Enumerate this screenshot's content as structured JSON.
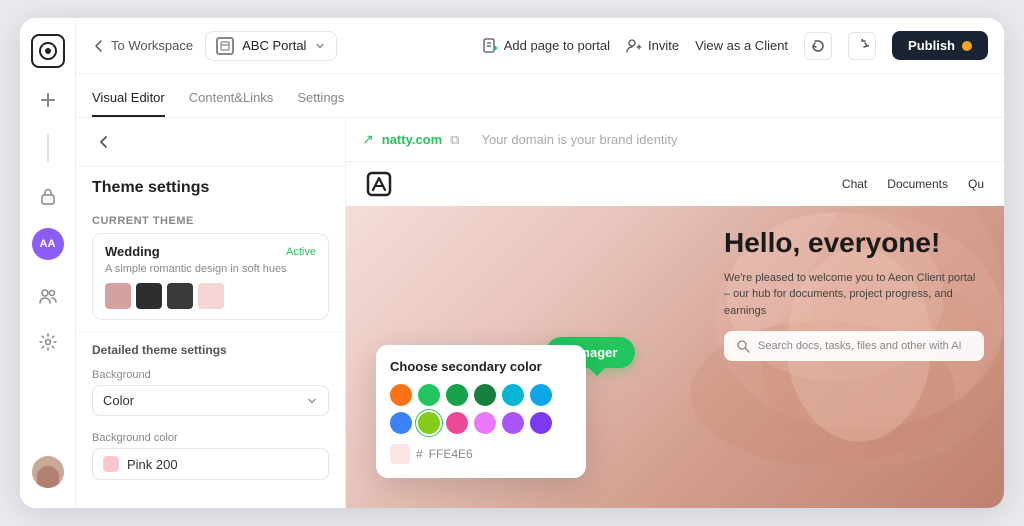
{
  "app": {
    "title": "ABC Portal"
  },
  "sidebar": {
    "logo_text": "AA",
    "icons": [
      "⊕",
      "🔒",
      "👥",
      "⚙️"
    ]
  },
  "topbar": {
    "back_label": "To Workspace",
    "portal_name": "ABC Portal",
    "add_page_label": "Add page to portal",
    "invite_label": "Invite",
    "view_client_label": "View as a Client",
    "publish_label": "Publish"
  },
  "tabs": {
    "items": [
      {
        "label": "Visual Editor",
        "active": true
      },
      {
        "label": "Content&Links",
        "active": false
      },
      {
        "label": "Settings",
        "active": false
      }
    ]
  },
  "settings_panel": {
    "title": "Theme settings",
    "current_theme_section": "Current theme",
    "theme_name": "Wedding",
    "theme_badge": "Active",
    "theme_desc": "A simple romantic design in soft hues",
    "theme_colors": [
      "#d4a0a0",
      "#2d2d2d",
      "#3a3a3a",
      "#f5d5d5"
    ],
    "detailed_section": "Detailed theme settings",
    "background_label": "Background",
    "background_value": "Color",
    "bg_color_label": "Background color",
    "bg_color_name": "Pink 200",
    "bg_color_hex": "#f8c8cc"
  },
  "preview": {
    "url": "natty.com",
    "url_tagline": "Your domain is your brand identity",
    "nav_links": [
      "Chat",
      "Documents",
      "Qu"
    ],
    "hero_title": "Hello, everyone!",
    "hero_desc": "We're pleased to welcome you to Aeon Client portal – our hub for documents, project progress, and earnings",
    "search_placeholder": "Search docs, tasks, files and other with AI",
    "manager_tooltip": "Manager"
  },
  "color_picker": {
    "title": "Choose secondary color",
    "hex_label": "FFE4E6",
    "colors": [
      {
        "hex": "#f97316",
        "selected": false
      },
      {
        "hex": "#22c55e",
        "selected": false
      },
      {
        "hex": "#16a34a",
        "selected": false
      },
      {
        "hex": "#15803d",
        "selected": false
      },
      {
        "hex": "#06b6d4",
        "selected": false
      },
      {
        "hex": "#0ea5e9",
        "selected": false
      },
      {
        "hex": "#3b82f6",
        "selected": false
      },
      {
        "hex": "#84cc16",
        "selected": true
      },
      {
        "hex": "#ec4899",
        "selected": false
      },
      {
        "hex": "#e879f9",
        "selected": false
      },
      {
        "hex": "#a855f7",
        "selected": false
      },
      {
        "hex": "#7c3aed",
        "selected": false
      }
    ]
  }
}
